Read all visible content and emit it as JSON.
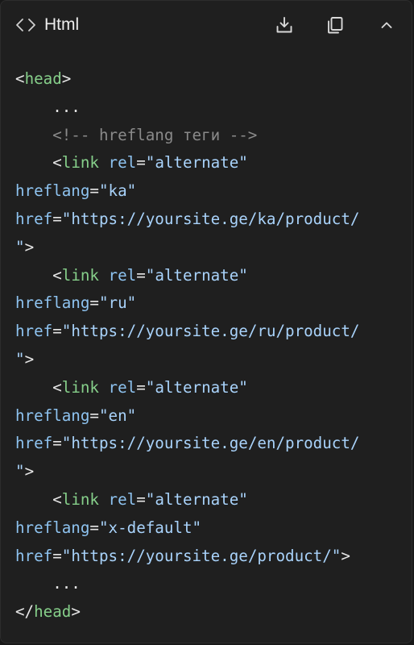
{
  "header": {
    "language": "Html",
    "icons": {
      "language": "code-brackets-icon",
      "download": "download-icon",
      "copy": "copy-icon",
      "collapse": "chevron-up-icon"
    }
  },
  "code": {
    "lines": [
      [
        [
          "p",
          "<"
        ],
        [
          "t",
          "head"
        ],
        [
          "p",
          ">"
        ]
      ],
      [
        [
          "p",
          "    ..."
        ]
      ],
      [
        [
          "c",
          "    <!-- hreflang теги -->"
        ]
      ],
      [
        [
          "p",
          "    <"
        ],
        [
          "t",
          "link"
        ],
        [
          "p",
          " "
        ],
        [
          "a",
          "rel"
        ],
        [
          "p",
          "="
        ],
        [
          "s",
          "\"alternate\""
        ]
      ],
      [
        [
          "a",
          "hreflang"
        ],
        [
          "p",
          "="
        ],
        [
          "s",
          "\"ka\""
        ]
      ],
      [
        [
          "a",
          "href"
        ],
        [
          "p",
          "="
        ],
        [
          "s",
          "\"https://yoursite.ge/ka/product/"
        ]
      ],
      [
        [
          "s",
          "\""
        ],
        [
          "p",
          ">"
        ]
      ],
      [
        [
          "p",
          "    <"
        ],
        [
          "t",
          "link"
        ],
        [
          "p",
          " "
        ],
        [
          "a",
          "rel"
        ],
        [
          "p",
          "="
        ],
        [
          "s",
          "\"alternate\""
        ]
      ],
      [
        [
          "a",
          "hreflang"
        ],
        [
          "p",
          "="
        ],
        [
          "s",
          "\"ru\""
        ]
      ],
      [
        [
          "a",
          "href"
        ],
        [
          "p",
          "="
        ],
        [
          "s",
          "\"https://yoursite.ge/ru/product/"
        ]
      ],
      [
        [
          "s",
          "\""
        ],
        [
          "p",
          ">"
        ]
      ],
      [
        [
          "p",
          "    <"
        ],
        [
          "t",
          "link"
        ],
        [
          "p",
          " "
        ],
        [
          "a",
          "rel"
        ],
        [
          "p",
          "="
        ],
        [
          "s",
          "\"alternate\""
        ]
      ],
      [
        [
          "a",
          "hreflang"
        ],
        [
          "p",
          "="
        ],
        [
          "s",
          "\"en\""
        ]
      ],
      [
        [
          "a",
          "href"
        ],
        [
          "p",
          "="
        ],
        [
          "s",
          "\"https://yoursite.ge/en/product/"
        ]
      ],
      [
        [
          "s",
          "\""
        ],
        [
          "p",
          ">"
        ]
      ],
      [
        [
          "p",
          "    <"
        ],
        [
          "t",
          "link"
        ],
        [
          "p",
          " "
        ],
        [
          "a",
          "rel"
        ],
        [
          "p",
          "="
        ],
        [
          "s",
          "\"alternate\""
        ]
      ],
      [
        [
          "a",
          "hreflang"
        ],
        [
          "p",
          "="
        ],
        [
          "s",
          "\"x-default\""
        ]
      ],
      [
        [
          "a",
          "href"
        ],
        [
          "p",
          "="
        ],
        [
          "s",
          "\"https://yoursite.ge/product/\""
        ],
        [
          "p",
          ">"
        ]
      ],
      [
        [
          "p",
          "    ..."
        ]
      ],
      [
        [
          "p",
          "</"
        ],
        [
          "t",
          "head"
        ],
        [
          "p",
          ">"
        ]
      ]
    ]
  }
}
